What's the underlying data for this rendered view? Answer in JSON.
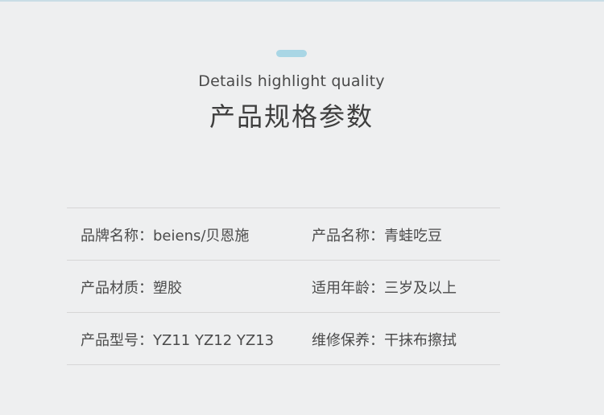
{
  "header": {
    "subtitle": "Details highlight quality",
    "title": "产品规格参数",
    "accent_color": "#a9d6e5"
  },
  "specs": [
    {
      "left": "品牌名称：beiens/贝恩施",
      "right": "产品名称：青蛙吃豆"
    },
    {
      "left": "产品材质：塑胶",
      "right": "适用年龄：三岁及以上"
    },
    {
      "left": "产品型号：YZ11 YZ12  YZ13",
      "right": "维修保养：干抹布擦拭"
    }
  ]
}
